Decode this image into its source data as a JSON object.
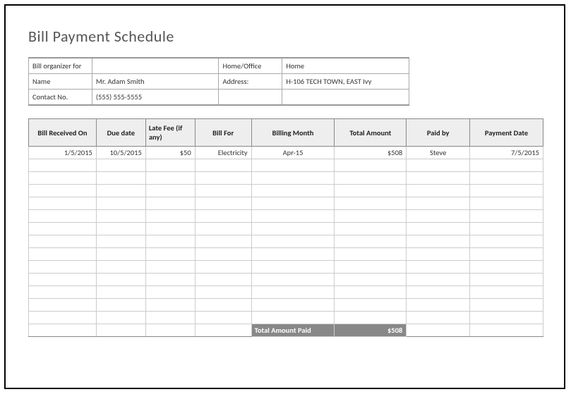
{
  "title": "Bill Payment Schedule",
  "info": {
    "organizer_label": "Bill organizer for",
    "organizer_value": "",
    "homeoffice_label": "Home/Office",
    "homeoffice_value": "Home",
    "name_label": "Name",
    "name_value": "Mr. Adam Smith",
    "address_label": "Address:",
    "address_value": "H-106 TECH TOWN, EAST Ivy",
    "contact_label": "Contact No.",
    "contact_value": "(555) 555-5555"
  },
  "headers": {
    "h0": "Bill Received On",
    "h1": "Due date",
    "h2": "Late Fee (if any)",
    "h3": "Bill For",
    "h4": "Billing Month",
    "h5": "Total Amount",
    "h6": "Paid by",
    "h7": "Payment Date"
  },
  "row": {
    "c0": "1/5/2015",
    "c1": "10/5/2015",
    "c2": "$50",
    "c3": "Electricity",
    "c4": "Apr-15",
    "c5": "$508",
    "c6": "Steve",
    "c7": "7/5/2015"
  },
  "footer": {
    "label": "Total Amount Paid",
    "value": "$508"
  }
}
